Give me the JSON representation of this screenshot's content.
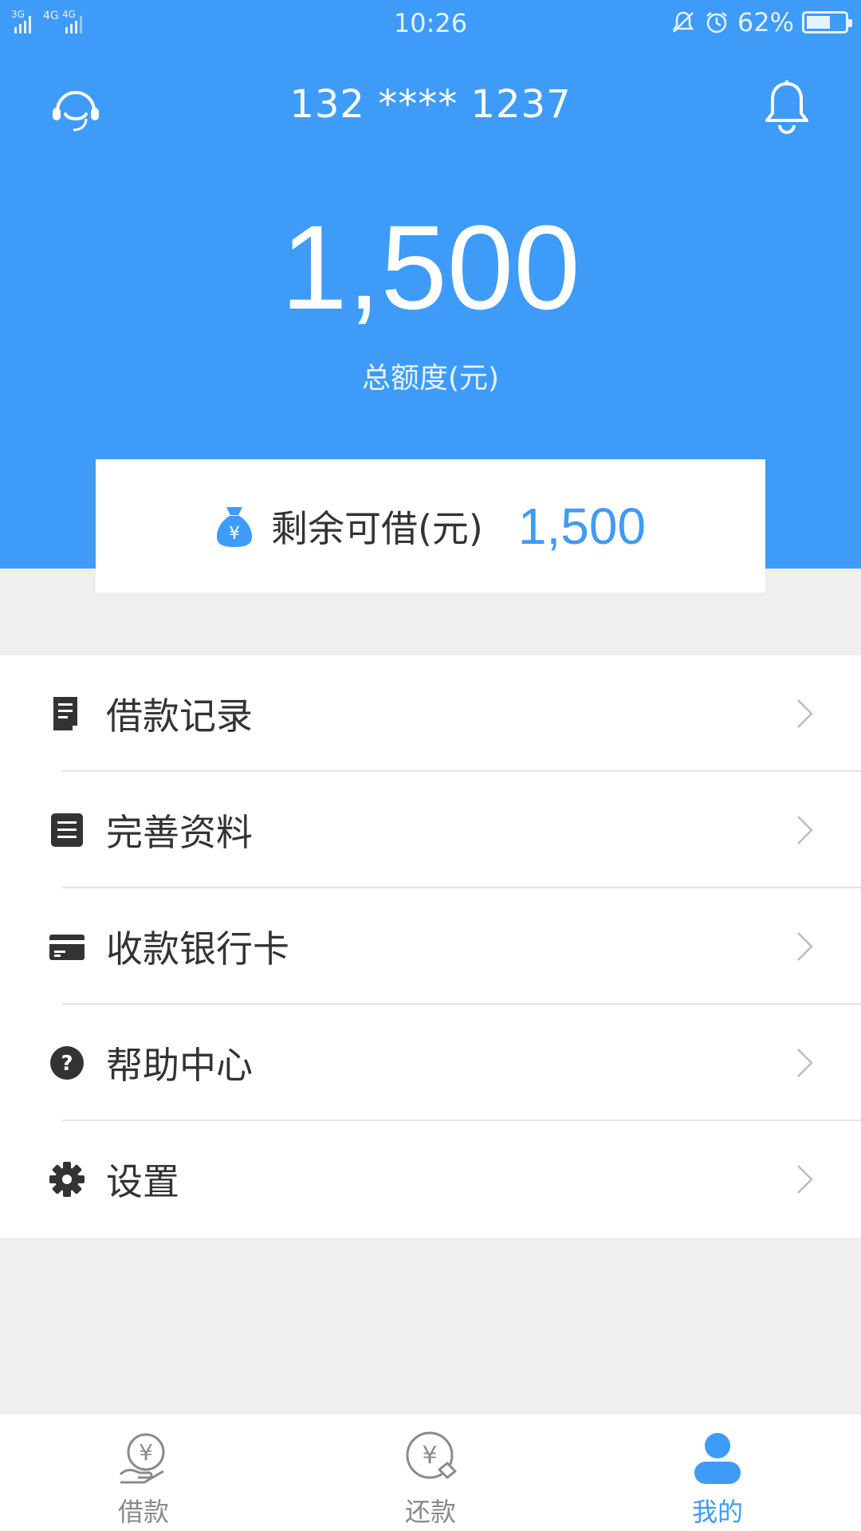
{
  "status_bar": {
    "signal_text": "3G 4G 4G",
    "time": "10:26",
    "battery_percent": "62%",
    "battery_level": 0.62
  },
  "header": {
    "phone": "132 **** 1237",
    "total_amount": "1,500",
    "total_label": "总额度(元)"
  },
  "remain": {
    "label": "剩余可借(元)",
    "value": "1,500"
  },
  "menu": [
    {
      "label": "借款记录",
      "icon": "loan-record-icon"
    },
    {
      "label": "完善资料",
      "icon": "profile-doc-icon"
    },
    {
      "label": "收款银行卡",
      "icon": "bank-card-icon"
    },
    {
      "label": "帮助中心",
      "icon": "help-icon"
    },
    {
      "label": "设置",
      "icon": "gear-icon"
    }
  ],
  "tabs": [
    {
      "label": "借款",
      "icon": "borrow-icon",
      "active": false
    },
    {
      "label": "还款",
      "icon": "repay-icon",
      "active": false
    },
    {
      "label": "我的",
      "icon": "user-icon",
      "active": true
    }
  ],
  "colors": {
    "primary": "#3f9bf8",
    "background": "#efefef",
    "text": "#333333"
  }
}
